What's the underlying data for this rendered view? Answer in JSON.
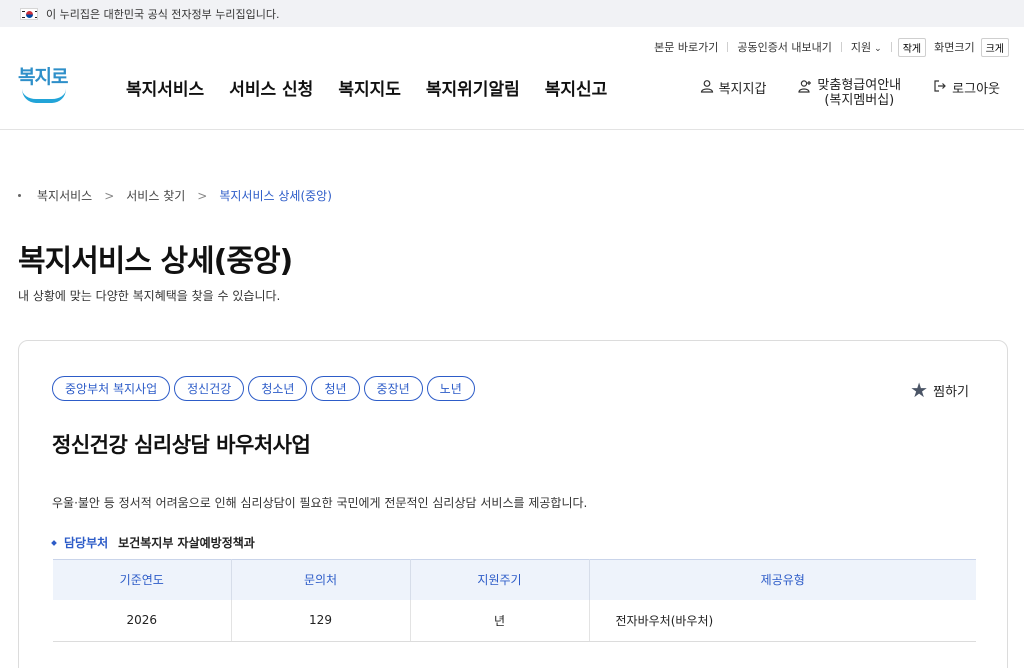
{
  "gov_banner": {
    "text": "이 누리집은 대한민국 공식 전자정부 누리집입니다."
  },
  "utility": {
    "skip_link": "본문 바로가기",
    "cert_export": "공동인증서 내보내기",
    "support": "지원",
    "font_small": "작게",
    "font_size_label": "화면크기",
    "font_large": "크게"
  },
  "logo": {
    "text": "복지로"
  },
  "gnb": [
    "복지서비스",
    "서비스 신청",
    "복지지도",
    "복지위기알림",
    "복지신고"
  ],
  "header_actions": {
    "wallet": "복지지갑",
    "membership_line1": "맞춤형급여안내",
    "membership_line2": "(복지멤버십)",
    "logout": "로그아웃"
  },
  "breadcrumb": [
    "복지서비스",
    "서비스 찾기",
    "복지서비스 상세(중앙)"
  ],
  "page": {
    "title": "복지서비스 상세(중앙)",
    "description": "내 상황에 맞는 다양한 복지혜택을 찾을 수 있습니다."
  },
  "service": {
    "tags": [
      "중앙부처 복지사업",
      "정신건강",
      "청소년",
      "청년",
      "중장년",
      "노년"
    ],
    "favorite_label": "찜하기",
    "title": "정신건강 심리상담 바우처사업",
    "description": "우울·불안 등 정서적 어려움으로 인해 심리상담이 필요한 국민에게 전문적인 심리상담 서비스를 제공합니다.",
    "department_label": "담당부처",
    "department_value": "보건복지부 자살예방정책과",
    "table": {
      "headers": [
        "기준연도",
        "문의처",
        "지원주기",
        "제공유형"
      ],
      "rows": [
        [
          "2026",
          "129",
          "년",
          "전자바우처(바우처)"
        ]
      ]
    }
  },
  "colors": {
    "accent": "#2d5cc8",
    "table_header_bg": "#eef3fb",
    "banner_bg": "#f1f2f5"
  },
  "icons": {
    "flag": "korea-flag-icon",
    "favorite": "star-icon",
    "wallet": "person-icon",
    "membership": "person-add-icon",
    "logout": "logout-icon",
    "support": "chevron-down-icon"
  }
}
